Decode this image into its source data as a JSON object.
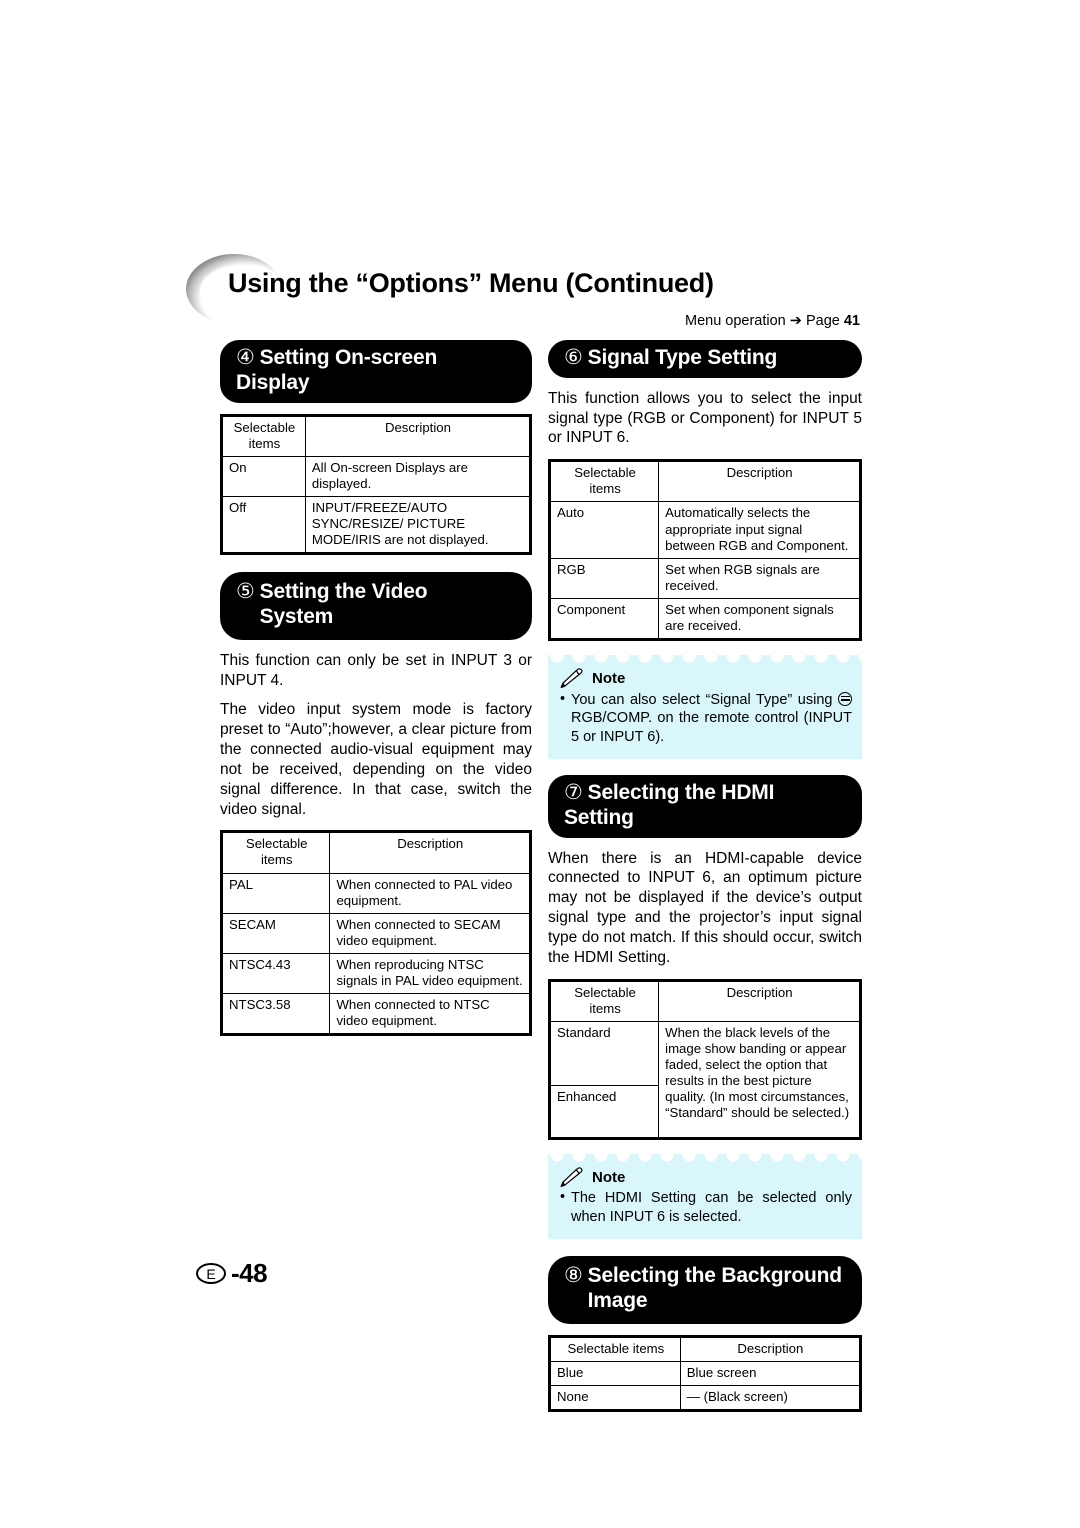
{
  "header": {
    "title": "Using the “Options” Menu (Continued)",
    "menu_operation_label": "Menu operation ➔ Page ",
    "menu_operation_page": "41"
  },
  "footer": {
    "region_mark": "E",
    "page_number": "-48"
  },
  "colors": {
    "banner_bg": "#000000",
    "banner_text": "#ffffff",
    "note_bg": "#d9f7fb",
    "page_bg": "#ffffff"
  },
  "sections": {
    "onscreen_display": {
      "number": "④",
      "title": "Setting On-screen Display",
      "table": {
        "headers": [
          "Selectable items",
          "Description"
        ],
        "rows": [
          [
            "On",
            "All On-screen Displays are displayed."
          ],
          [
            "Off",
            "INPUT/FREEZE/AUTO SYNC/RESIZE/ PICTURE MODE/IRIS are not displayed."
          ]
        ]
      }
    },
    "video_system": {
      "number": "⑤",
      "title_line1": "Setting the Video",
      "title_line2": "System",
      "paragraph1": "This function can only be set in INPUT 3 or INPUT 4.",
      "paragraph2": "The video input system mode is factory preset to “Auto”;however, a clear picture from the connected audio-visual equipment may not be received, depending on the video signal difference. In that case, switch the video signal.",
      "table": {
        "headers": [
          "Selectable items",
          "Description"
        ],
        "rows": [
          [
            "PAL",
            "When connected to PAL video equipment."
          ],
          [
            "SECAM",
            "When connected to SECAM video equipment."
          ],
          [
            "NTSC4.43",
            "When reproducing NTSC signals in PAL video equipment."
          ],
          [
            "NTSC3.58",
            "When connected to NTSC video equipment."
          ]
        ]
      }
    },
    "signal_type": {
      "number": "⑥",
      "title": "Signal Type Setting",
      "paragraph1": "This function allows you to select the input signal type (RGB or Component) for INPUT 5 or INPUT 6.",
      "table": {
        "headers": [
          "Selectable items",
          "Description"
        ],
        "rows": [
          [
            "Auto",
            "Automatically selects the appropriate input signal between RGB and Component."
          ],
          [
            "RGB",
            "Set when RGB signals are received."
          ],
          [
            "Component",
            "Set when component signals are received."
          ]
        ]
      },
      "note": {
        "title": "Note",
        "icon": "pencil-icon",
        "text_before": "You can also select “Signal Type” using ",
        "inline_icon": "rgb-comp-button-icon",
        "text_after": " RGB/COMP. on the remote control (INPUT 5 or INPUT 6)."
      }
    },
    "hdmi_setting": {
      "number": "⑦",
      "title": "Selecting the HDMI Setting",
      "paragraph1": "When there is an HDMI-capable device connected to INPUT 6, an optimum picture may not be displayed if the device’s output signal type and the projector’s input signal type do not match. If this should occur, switch the HDMI Setting.",
      "table": {
        "headers": [
          "Selectable items",
          "Description"
        ],
        "row_labels": [
          "Standard",
          "Enhanced"
        ],
        "merged_description": "When the black levels of the image show banding or appear faded, select the option that results in the best picture quality. (In most circumstances, “Standard” should be selected.)"
      },
      "note": {
        "title": "Note",
        "icon": "pencil-icon",
        "text": "The HDMI Setting can be selected only when INPUT 6 is selected."
      }
    },
    "background_image": {
      "number": "⑧",
      "title_line1": "Selecting the Background",
      "title_line2": "Image",
      "table": {
        "headers": [
          "Selectable items",
          "Description"
        ],
        "rows": [
          [
            "Blue",
            "Blue screen"
          ],
          [
            "None",
            "— (Black screen)"
          ]
        ]
      }
    }
  }
}
